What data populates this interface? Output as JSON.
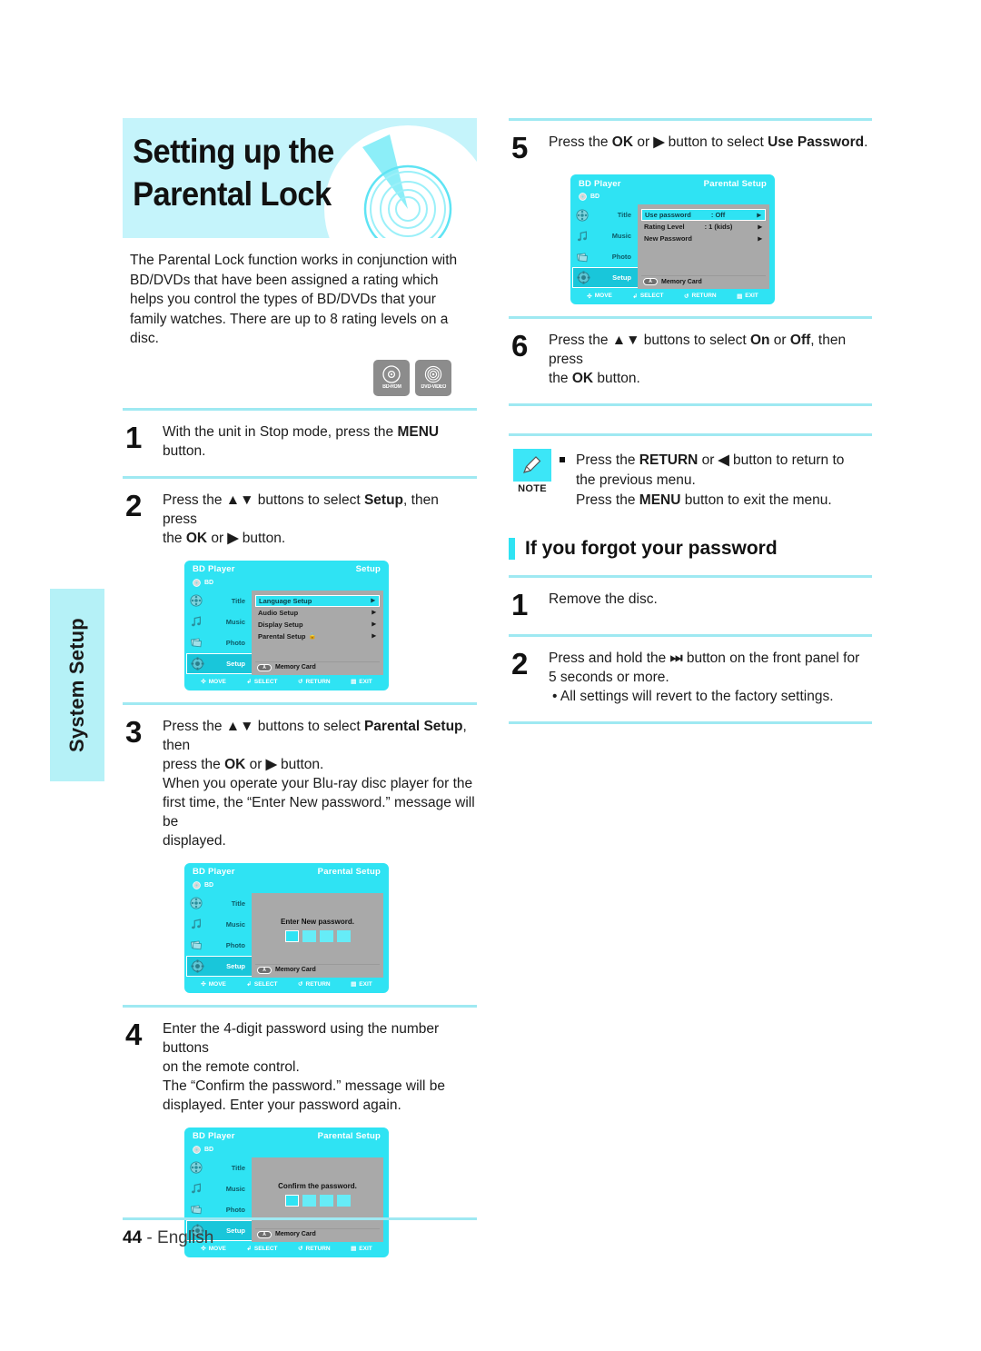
{
  "page": {
    "side_tab_label": "System Setup",
    "footer_page": "44",
    "footer_sep": " - ",
    "footer_language": "English"
  },
  "title": {
    "heading": "Setting up the Parental Lock",
    "intro": "The Parental Lock function works in conjunction with BD/DVDs that have been assigned a rating which helps you control the types of BD/DVDs that your family watches. There are up to 8 rating levels on a disc.",
    "logos": [
      {
        "name": "bd-rom-logo",
        "caption": "BD-ROM"
      },
      {
        "name": "dvd-video-logo",
        "caption": "DVD-VIDEO"
      }
    ]
  },
  "steps_left": [
    {
      "num": "1",
      "lines": [
        [
          {
            "t": "With the unit in Stop mode, press the "
          },
          {
            "t": "MENU",
            "b": true
          }
        ],
        [
          {
            "t": "button."
          }
        ]
      ]
    },
    {
      "num": "2",
      "lines": [
        [
          {
            "t": "Press the "
          },
          {
            "t": "▲▼",
            "b": true
          },
          {
            "t": " buttons to select "
          },
          {
            "t": "Setup",
            "b": true
          },
          {
            "t": ", then press"
          }
        ],
        [
          {
            "t": "the "
          },
          {
            "t": "OK",
            "b": true
          },
          {
            "t": " or "
          },
          {
            "t": "▶",
            "b": true
          },
          {
            "t": " button."
          }
        ]
      ]
    },
    {
      "num": "3",
      "lines": [
        [
          {
            "t": "Press the "
          },
          {
            "t": "▲▼",
            "b": true
          },
          {
            "t": " buttons to select "
          },
          {
            "t": "Parental Setup",
            "b": true
          },
          {
            "t": ", then"
          }
        ],
        [
          {
            "t": "press the "
          },
          {
            "t": "OK",
            "b": true
          },
          {
            "t": " or "
          },
          {
            "t": "▶",
            "b": true
          },
          {
            "t": " button."
          }
        ],
        [
          {
            "t": "When you operate your Blu-ray disc player for the"
          }
        ],
        [
          {
            "t": "first time, the “Enter New password.” message will be"
          }
        ],
        [
          {
            "t": "displayed."
          }
        ]
      ]
    },
    {
      "num": "4",
      "lines": [
        [
          {
            "t": "Enter the 4-digit password using the number buttons"
          }
        ],
        [
          {
            "t": "on the remote control."
          }
        ],
        [
          {
            "t": "The “Confirm the password.” message will be"
          }
        ],
        [
          {
            "t": "displayed. Enter your password again."
          }
        ]
      ]
    }
  ],
  "steps_right": [
    {
      "num": "5",
      "lines": [
        [
          {
            "t": "Press the "
          },
          {
            "t": "OK",
            "b": true
          },
          {
            "t": " or "
          },
          {
            "t": "▶",
            "b": true
          },
          {
            "t": " button to select "
          },
          {
            "t": "Use Password",
            "b": true
          },
          {
            "t": "."
          }
        ]
      ]
    },
    {
      "num": "6",
      "lines": [
        [
          {
            "t": "Press the "
          },
          {
            "t": "▲▼",
            "b": true
          },
          {
            "t": " buttons to select "
          },
          {
            "t": "On",
            "b": true
          },
          {
            "t": " or "
          },
          {
            "t": "Off",
            "b": true
          },
          {
            "t": ", then press"
          }
        ],
        [
          {
            "t": "the "
          },
          {
            "t": "OK",
            "b": true
          },
          {
            "t": " button."
          }
        ]
      ]
    }
  ],
  "note": {
    "label": "NOTE",
    "icon": "pencil-icon",
    "lines": [
      [
        {
          "t": "Press the "
        },
        {
          "t": "RETURN",
          "b": true
        },
        {
          "t": " or "
        },
        {
          "t": "◀",
          "b": true
        },
        {
          "t": " button to return to"
        }
      ],
      [
        {
          "t": "the previous menu."
        }
      ],
      [
        {
          "t": "Press the "
        },
        {
          "t": "MENU",
          "b": true
        },
        {
          "t": " button to exit the menu."
        }
      ]
    ]
  },
  "forgot_section": {
    "title": "If you forgot your password",
    "steps": [
      {
        "num": "1",
        "lines": [
          [
            {
              "t": "Remove the disc."
            }
          ]
        ]
      },
      {
        "num": "2",
        "lines": [
          [
            {
              "t": "Press and hold the "
            },
            {
              "t": "⏭",
              "b": true
            },
            {
              "t": " button on the front panel for"
            }
          ],
          [
            {
              "t": "5 seconds or more."
            }
          ]
        ],
        "bullets": [
          "• All settings will revert to the factory settings."
        ]
      }
    ]
  },
  "osd_common": {
    "brand": "BD Player",
    "source_label": "BD",
    "nav": [
      {
        "label": "Title",
        "icon": "film-reel-icon"
      },
      {
        "label": "Music",
        "icon": "music-note-icon"
      },
      {
        "label": "Photo",
        "icon": "photos-icon"
      },
      {
        "label": "Setup",
        "icon": "gear-icon"
      }
    ],
    "memory_card_label": "Memory Card",
    "memory_card_button": "A",
    "footer_buttons": [
      {
        "label": "MOVE",
        "icon": "dpad-icon"
      },
      {
        "label": "SELECT",
        "icon": "enter-icon"
      },
      {
        "label": "RETURN",
        "icon": "return-arrow-icon"
      },
      {
        "label": "EXIT",
        "icon": "exit-icon"
      }
    ]
  },
  "osd_setup": {
    "title_right": "Setup",
    "active_nav": "Setup",
    "rows": [
      {
        "label": "Language Setup",
        "value": "",
        "selected": true
      },
      {
        "label": "Audio Setup",
        "value": "",
        "selected": false
      },
      {
        "label": "Display Setup",
        "value": "",
        "selected": false
      },
      {
        "label": "Parental Setup",
        "value": "",
        "selected": false,
        "lock": true
      }
    ]
  },
  "osd_enter_new": {
    "title_right": "Parental Setup",
    "active_nav": "Setup",
    "message": "Enter New password.",
    "boxes": 4
  },
  "osd_confirm": {
    "title_right": "Parental Setup",
    "active_nav": "Setup",
    "message": "Confirm the password.",
    "boxes": 4
  },
  "osd_parental": {
    "title_right": "Parental Setup",
    "active_nav": "Setup",
    "rows": [
      {
        "label": "Use password",
        "value": ": Off",
        "selected": true
      },
      {
        "label": "Rating Level",
        "value": ": 1 (kids)",
        "selected": false
      },
      {
        "label": "New Password",
        "value": "",
        "selected": false
      }
    ]
  },
  "colors": {
    "cyan": "#2fe3f3",
    "banner_bg": "#c5f4fb",
    "rule": "#9fe9f2",
    "osd_panel": "#a9a9a9",
    "logo_gray": "#8c8c8c"
  }
}
